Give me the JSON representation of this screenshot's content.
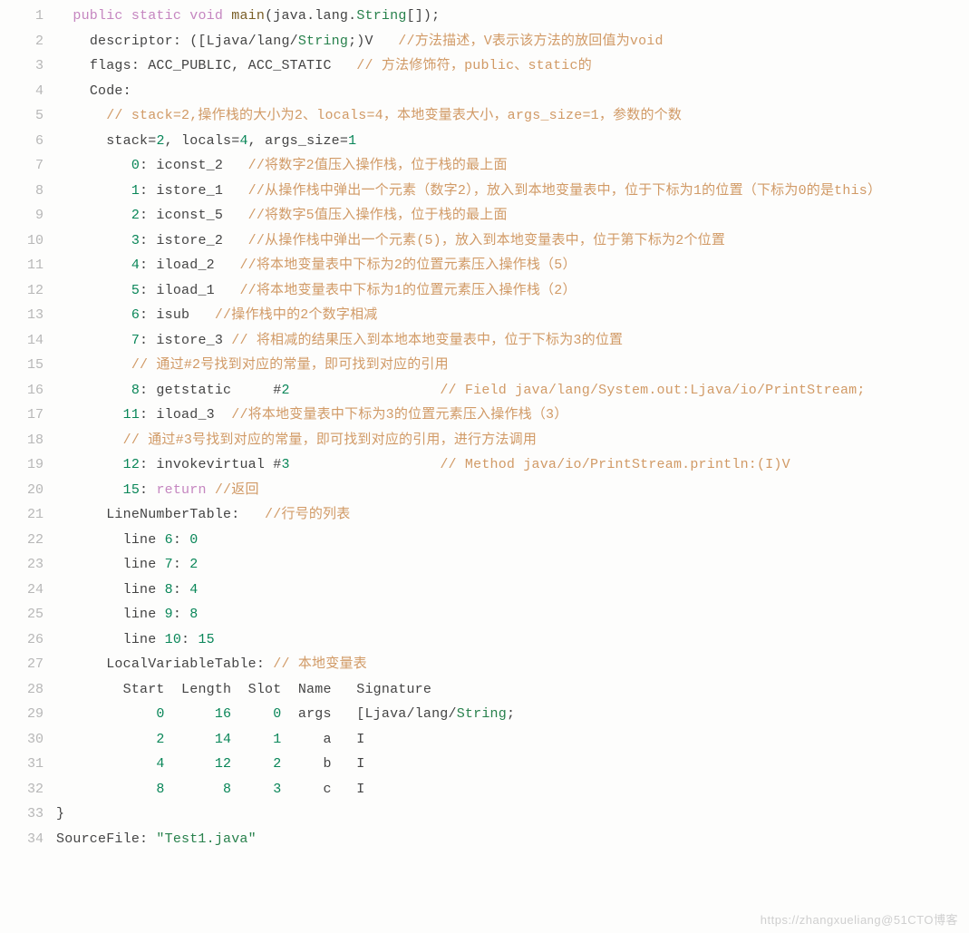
{
  "watermark": "https://zhangxueliang@51CTO博客",
  "gutters": [
    "1",
    "2",
    "3",
    "4",
    "5",
    "6",
    "7",
    "8",
    "9",
    "10",
    "11",
    "12",
    "13",
    "14",
    "15",
    "16",
    "17",
    "18",
    "19",
    "20",
    "21",
    "22",
    "23",
    "24",
    "25",
    "26",
    "27",
    "28",
    "29",
    "30",
    "31",
    "32",
    "33",
    "34"
  ],
  "t": {
    "l1": {
      "indent": "  ",
      "kw1": "public",
      "sp1": " ",
      "kw2": "static",
      "sp2": " ",
      "kw3": "void",
      "sp3": " ",
      "fn": "main",
      "open": "(java.",
      "lang": "lang",
      "dot": ".",
      "str": "String",
      "arr": "[]);"
    },
    "l2": {
      "indent": "    ",
      "lbl": "descriptor: ([Ljava",
      "slash1": "/",
      "lang": "lang",
      "slash2": "/",
      "str": "String",
      "tail": ";)V   ",
      "cmt": "//方法描述，V表示该方法的放回值为void"
    },
    "l3": {
      "indent": "    ",
      "lbl": "flags: ACC_PUBLIC, ACC_STATIC   ",
      "cmt": "// 方法修饰符，public、static的"
    },
    "l4": {
      "indent": "    ",
      "lbl": "Code:"
    },
    "l5": {
      "indent": "      ",
      "cmt": "// stack=2,操作栈的大小为2、locals=4，本地变量表大小，args_size=1，参数的个数"
    },
    "l6": {
      "indent": "      ",
      "a": "stack=",
      "n1": "2",
      "b": ", locals=",
      "n2": "4",
      "c": ", args_size=",
      "n3": "1"
    },
    "l7": {
      "indent": "         ",
      "n": "0",
      "c": ": iconst_2   ",
      "cmt": "//将数字2值压入操作栈，位于栈的最上面"
    },
    "l8": {
      "indent": "         ",
      "n": "1",
      "c": ": istore_1   ",
      "cmt": "//从操作栈中弹出一个元素（数字2），放入到本地变量表中，位于下标为1的位置（下标为0的是this）"
    },
    "l9": {
      "indent": "         ",
      "n": "2",
      "c": ": iconst_5   ",
      "cmt": "//将数字5值压入操作栈，位于栈的最上面"
    },
    "l10": {
      "indent": "         ",
      "n": "3",
      "c": ": istore_2   ",
      "cmt": "//从操作栈中弹出一个元素(5)，放入到本地变量表中，位于第下标为2个位置"
    },
    "l11": {
      "indent": "         ",
      "n": "4",
      "c": ": iload_2   ",
      "cmt": "//将本地变量表中下标为2的位置元素压入操作栈（5）"
    },
    "l12": {
      "indent": "         ",
      "n": "5",
      "c": ": iload_1   ",
      "cmt": "//将本地变量表中下标为1的位置元素压入操作栈（2）"
    },
    "l13": {
      "indent": "         ",
      "n": "6",
      "c": ": isub   ",
      "cmt": "//操作栈中的2个数字相减"
    },
    "l14": {
      "indent": "         ",
      "n": "7",
      "c": ": istore_3 ",
      "cmt": "// 将相减的结果压入到本地本地变量表中，位于下标为3的位置"
    },
    "l15": {
      "indent": "         ",
      "cmt": "// 通过#2号找到对应的常量，即可找到对应的引用"
    },
    "l16": {
      "indent": "         ",
      "n": "8",
      "a": ": getstatic     #",
      "n2": "2",
      "pad": "                  ",
      "cmt": "// Field java/lang/System.out:Ljava/io/PrintStream;"
    },
    "l17": {
      "indent": "        ",
      "n": "11",
      "c": ": iload_3  ",
      "cmt": "//将本地变量表中下标为3的位置元素压入操作栈（3）"
    },
    "l18": {
      "indent": "        ",
      "cmt": "// 通过#3号找到对应的常量，即可找到对应的引用，进行方法调用"
    },
    "l19": {
      "indent": "        ",
      "n": "12",
      "a": ": invokevirtual #",
      "n2": "3",
      "pad": "                  ",
      "cmt": "// Method java/io/PrintStream.println:(I)V"
    },
    "l20": {
      "indent": "        ",
      "n": "15",
      "a": ": ",
      "ret": "return",
      "sp": " ",
      "cmt": "//返回"
    },
    "l21": {
      "indent": "      ",
      "lbl": "LineNumberTable:   ",
      "cmt": "//行号的列表"
    },
    "l22": {
      "indent": "        ",
      "a": "line ",
      "n1": "6",
      "b": ": ",
      "n2": "0"
    },
    "l23": {
      "indent": "        ",
      "a": "line ",
      "n1": "7",
      "b": ": ",
      "n2": "2"
    },
    "l24": {
      "indent": "        ",
      "a": "line ",
      "n1": "8",
      "b": ": ",
      "n2": "4"
    },
    "l25": {
      "indent": "        ",
      "a": "line ",
      "n1": "9",
      "b": ": ",
      "n2": "8"
    },
    "l26": {
      "indent": "        ",
      "a": "line ",
      "n1": "10",
      "b": ": ",
      "n2": "15"
    },
    "l27": {
      "indent": "      ",
      "lbl": "LocalVariableTable: ",
      "cmt": "// 本地变量表"
    },
    "l28": {
      "indent": "        ",
      "hdr": "Start  Length  Slot  Name   Signature"
    },
    "l29": {
      "indent": "            ",
      "n1": "0",
      "sp1": "      ",
      "n2": "16",
      "sp2": "     ",
      "n3": "0",
      "sp3": "  args   [Ljava",
      "sl1": "/",
      "lang": "lang",
      "sl2": "/",
      "str": "String",
      "semi": ";"
    },
    "l30": {
      "indent": "            ",
      "n1": "2",
      "sp1": "      ",
      "n2": "14",
      "sp2": "     ",
      "n3": "1",
      "sp3": "     a   I"
    },
    "l31": {
      "indent": "            ",
      "n1": "4",
      "sp1": "      ",
      "n2": "12",
      "sp2": "     ",
      "n3": "2",
      "sp3": "     b   I"
    },
    "l32": {
      "indent": "            ",
      "n1": "8",
      "sp1": "       ",
      "n2": "8",
      "sp2": "     ",
      "n3": "3",
      "sp3": "     c   I"
    },
    "l33": {
      "txt": "}"
    },
    "l34": {
      "a": "SourceFile: ",
      "q": "\"Test1.java\""
    }
  }
}
